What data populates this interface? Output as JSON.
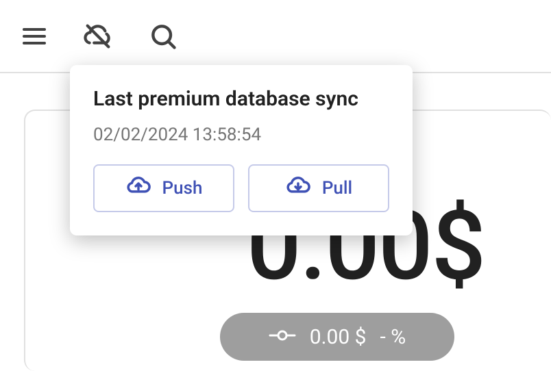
{
  "popover": {
    "title": "Last premium database sync",
    "date": "02/02/2024 13:58:54",
    "push_label": "Push",
    "pull_label": "Pull"
  },
  "main": {
    "big_amount": "0.00$",
    "pill_amount": "0.00 $",
    "pill_percent": "- %"
  }
}
